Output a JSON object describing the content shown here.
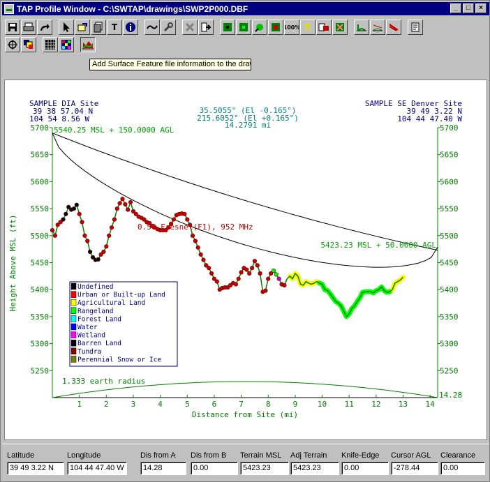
{
  "window": {
    "title": "TAP Profile Window - C:\\SWTAP\\drawings\\SWP2P000.DBF",
    "minimize": "_",
    "maximize": "□",
    "close": "×"
  },
  "tooltip": "Add Surface Feature file information to the drawi",
  "toolbar": {
    "row1": [
      "save-icon",
      "print-icon",
      "redo-icon",
      "",
      "pointer-icon",
      "hand-icon",
      "pages-icon",
      "text-tool-icon",
      "info-icon",
      "",
      "link-icon",
      "wrench-icon",
      "",
      "cancel-icon",
      "export-icon",
      "",
      "green-square-icon",
      "small-square-icon",
      "green-dot-icon",
      "red-square-icon",
      "percent-icon",
      "yellow-r-icon",
      "db-icon",
      "grid-export-icon",
      "",
      "profile-chart-icon",
      "profile-area-icon",
      "profile-red-icon",
      "",
      "notepad-icon"
    ],
    "percent_label": "100%",
    "r_label": "R",
    "info_label": "i",
    "text_label": "T"
  },
  "chart_data": {
    "type": "line",
    "site_a": {
      "name": "SAMPLE DIA Site",
      "lat": "39 38 57.04 N",
      "lon": "104 54 8.56 W"
    },
    "site_b": {
      "name": "SAMPLE SE Denver Site",
      "lat": "39 49 3.22 N",
      "lon": "104 44 47.40 W"
    },
    "header_center": [
      "35.5055° (El -0.165°)",
      "215.6052° (El +0.165°)",
      "14.2791 mi"
    ],
    "annot_a": "5540.25 MSL + 150.0000 AGL",
    "annot_b": "5423.23 MSL + 50.0000 AGL",
    "fresnel_label": "0.50 Fresnel(F1), 952 MHz",
    "earth_label": "1.333 earth radius",
    "xlabel": "Distance from Site (mi)",
    "ylabel": "Height Above MSL (ft)",
    "x_end_label": "14.28",
    "xlim": [
      0,
      14.28
    ],
    "ylim": [
      5200,
      5700
    ],
    "yticks": [
      5250,
      5300,
      5350,
      5400,
      5450,
      5500,
      5550,
      5600,
      5650,
      5700
    ],
    "xticks": [
      1,
      2,
      3,
      4,
      5,
      6,
      7,
      8,
      9,
      10,
      11,
      12,
      13,
      14
    ],
    "terrain": {
      "x": [
        0,
        0.1,
        0.2,
        0.3,
        0.4,
        0.5,
        0.6,
        0.7,
        0.8,
        0.9,
        1.0,
        1.1,
        1.2,
        1.3,
        1.4,
        1.5,
        1.6,
        1.7,
        1.8,
        1.9,
        2.0,
        2.1,
        2.2,
        2.3,
        2.4,
        2.5,
        2.6,
        2.7,
        2.8,
        2.9,
        3.0,
        3.1,
        3.2,
        3.3,
        3.4,
        3.5,
        3.6,
        3.7,
        3.8,
        3.9,
        4.0,
        4.1,
        4.2,
        4.3,
        4.4,
        4.5,
        4.6,
        4.7,
        4.8,
        4.9,
        5.0,
        5.1,
        5.2,
        5.3,
        5.4,
        5.5,
        5.6,
        5.7,
        5.8,
        5.9,
        6.0,
        6.1,
        6.2,
        6.3,
        6.4,
        6.5,
        6.6,
        6.7,
        6.8,
        6.9,
        7.0,
        7.1,
        7.2,
        7.3,
        7.4,
        7.5,
        7.6,
        7.7,
        7.8,
        7.9,
        8.0,
        8.1,
        8.2,
        8.3,
        8.4,
        8.5,
        8.6,
        8.7,
        8.8,
        8.9,
        9.0,
        9.1,
        9.2,
        9.3,
        9.4,
        9.5,
        9.6,
        9.7,
        9.8,
        9.9,
        10.0,
        10.1,
        10.2,
        10.3,
        10.4,
        10.5,
        10.6,
        10.7,
        10.8,
        10.9,
        11.0,
        11.1,
        11.2,
        11.3,
        11.4,
        11.5,
        11.6,
        11.7,
        11.8,
        11.9,
        12.0,
        12.1,
        12.2,
        12.3,
        12.4,
        12.5,
        12.6,
        12.7,
        12.8,
        12.9,
        13.0,
        13.1,
        13.2,
        13.3,
        13.4,
        13.5,
        13.6,
        13.7,
        13.8,
        13.9,
        14.0,
        14.1,
        14.2,
        14.28
      ],
      "y": [
        5510,
        5500,
        5520,
        5525,
        5530,
        5540,
        5553,
        5548,
        5550,
        5557,
        5540,
        5525,
        5500,
        5490,
        5470,
        5460,
        5455,
        5456,
        5465,
        5470,
        5480,
        5500,
        5515,
        5530,
        5550,
        5560,
        5568,
        5558,
        5548,
        5562,
        5545,
        5540,
        5535,
        5533,
        5530,
        5525,
        5523,
        5518,
        5515,
        5512,
        5510,
        5510,
        5510,
        5515,
        5522,
        5530,
        5538,
        5540,
        5541,
        5540,
        5530,
        5520,
        5500,
        5490,
        5478,
        5465,
        5455,
        5445,
        5440,
        5430,
        5420,
        5415,
        5400,
        5403,
        5404,
        5404,
        5408,
        5412,
        5410,
        5420,
        5432,
        5440,
        5437,
        5430,
        5440,
        5453,
        5445,
        5430,
        5396,
        5398,
        5420,
        5430,
        5435,
        5428,
        5420,
        5410,
        5408,
        5420,
        5425,
        5420,
        5430,
        5425,
        5410,
        5408,
        5415,
        5412,
        5410,
        5412,
        5415,
        5412,
        5410,
        5400,
        5398,
        5392,
        5385,
        5378,
        5375,
        5370,
        5360,
        5350,
        5355,
        5365,
        5370,
        5378,
        5385,
        5395,
        5396,
        5396,
        5396,
        5394,
        5398,
        5400,
        5405,
        5398,
        5395,
        5396,
        5400,
        5412,
        5415,
        5418,
        5423
      ]
    },
    "legend": [
      {
        "label": "Undefined",
        "color": "#000000"
      },
      {
        "label": "Urban or Built-up Land",
        "color": "#ff0000"
      },
      {
        "label": "Agricultural Land",
        "color": "#ffff00"
      },
      {
        "label": "Rangeland",
        "color": "#00ff00"
      },
      {
        "label": "Forest Land",
        "color": "#00ffff"
      },
      {
        "label": "Water",
        "color": "#0000ff"
      },
      {
        "label": "Wetland",
        "color": "#ff00ff"
      },
      {
        "label": "Barren Land",
        "color": "#000000"
      },
      {
        "label": "Tundra",
        "color": "#800000"
      },
      {
        "label": "Perennial Snow or Ice",
        "color": "#808000"
      }
    ]
  },
  "status": {
    "fields": [
      {
        "label": "Latitude",
        "value": "39 49 3.22 N"
      },
      {
        "label": "Longitude",
        "value": "104 44 47.40 W"
      },
      {
        "label": "Dis from A",
        "value": "14.28"
      },
      {
        "label": "Dis from B",
        "value": "0.00"
      },
      {
        "label": "Terrain MSL",
        "value": "5423.23"
      },
      {
        "label": "Adj Terrain",
        "value": "5423.23"
      },
      {
        "label": "Knife-Edge",
        "value": "0.00"
      },
      {
        "label": "Cursor AGL",
        "value": "-278.44"
      },
      {
        "label": "Clearance",
        "value": "0.00"
      }
    ]
  }
}
